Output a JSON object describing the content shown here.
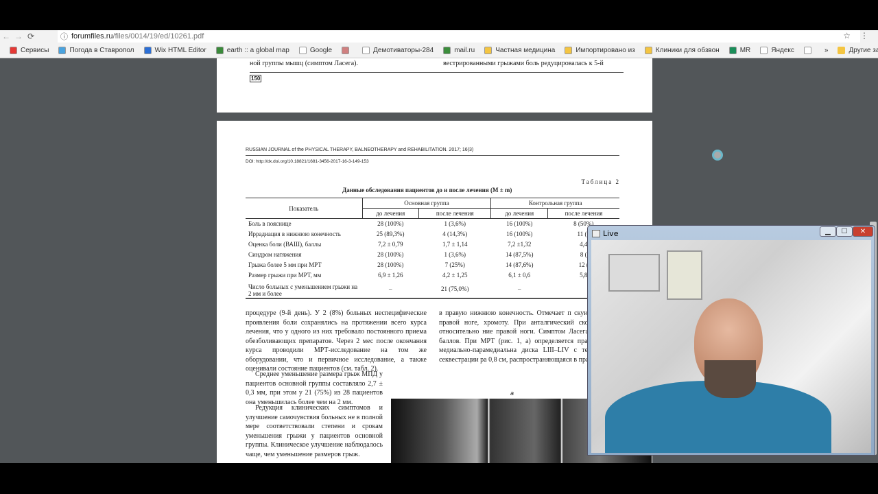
{
  "browser": {
    "url_host": "forumfiles.ru",
    "url_path": "/files/0014/19/ed/10261.pdf",
    "back_icon": "arrow-left-icon",
    "forward_icon": "arrow-right-icon",
    "reload_icon": "reload-icon",
    "info_icon": "info-icon",
    "star_icon": "star-icon",
    "menu_icon": "kebab-menu-icon"
  },
  "bookmarks": [
    {
      "label": "Сервисы",
      "icon": "apps-icon",
      "color": "#e53935"
    },
    {
      "label": "Погода в Ставропол",
      "icon": "weather-icon",
      "color": "#4aa3df"
    },
    {
      "label": "Wix HTML Editor",
      "icon": "wix-icon",
      "color": "#2b6fd6"
    },
    {
      "label": "earth :: a global map",
      "icon": "earth-icon",
      "color": "#3a8a3a"
    },
    {
      "label": "Google",
      "icon": "page-icon",
      "color": "#ffffff"
    },
    {
      "label": "",
      "icon": "avatar-icon",
      "color": "#d08080"
    },
    {
      "label": "Демотиваторы-284",
      "icon": "demotivator-icon",
      "color": "#ffffff"
    },
    {
      "label": "mail.ru",
      "icon": "mailru-icon",
      "color": "#3c8d3c"
    },
    {
      "label": "Частная медицина",
      "icon": "folder-icon",
      "color": "#f4c542"
    },
    {
      "label": "Импортировано из",
      "icon": "folder-icon",
      "color": "#f4c542"
    },
    {
      "label": "Клиники для обзвон",
      "icon": "folder-icon",
      "color": "#f4c542"
    },
    {
      "label": "MR",
      "icon": "mr-icon",
      "color": "#1b8e5a"
    },
    {
      "label": "Яндекс",
      "icon": "page-icon",
      "color": "#ffffff"
    },
    {
      "label": "",
      "icon": "page-icon",
      "color": "#ffffff"
    }
  ],
  "bookmarks_more": "»",
  "bookmarks_other": "Другие закладки",
  "page1": {
    "left_text": "ной группы мышц (симптом Ласега).",
    "right_text": "вестрированными грыжами боль редуцировалась к 5-й",
    "page_number": "150"
  },
  "page2": {
    "journal": "RUSSIAN JOURNAL of the PHYSICAL THERAPY, BALNEOTHERAPY and REHABILITATION. 2017; 16(3)",
    "doi": "DOI: http://dx.doi.org/10.18821/1681-3456-2017-16-3-149-153",
    "table_label": "Таблица 2",
    "table_title": "Данные обследования пациентов до и после лечения (M ± m)",
    "table": {
      "col_indicator": "Показатель",
      "group_main": "Основная группа",
      "group_control": "Контрольная группа",
      "sub": [
        "до лечения",
        "после лечения",
        "до лечения",
        "после лечения"
      ],
      "rows": [
        [
          "Боль в пояснице",
          "28 (100%)",
          "1 (3,6%)",
          "16 (100%)",
          "8 (50%)"
        ],
        [
          "Иррадиация в нижнюю конечность",
          "25 (89,3%)",
          "4 (14,3%)",
          "16 (100%)",
          "11 (6"
        ],
        [
          "Оценка боли (ВАШ), баллы",
          "7,2 ± 0,79",
          "1,7 ± 1,14",
          "7,2 ±1,32",
          "4,4"
        ],
        [
          "Синдром натяжения",
          "28 (100%)",
          "1 (3,6%)",
          "14 (87,5%)",
          "8 ("
        ],
        [
          "Грыжа более 5 мм при МРТ",
          "28 (100%)",
          "7 (25%)",
          "14 (87,6%)",
          "12 ("
        ],
        [
          "Размер грыжи при МРТ, мм",
          "6,9 ± 1,26",
          "4,2 ± 1,25",
          "6,1 ± 0,6",
          "5,8"
        ],
        [
          "Число больных с уменьшением грыжи на 2 мм и более",
          "–",
          "21 (75,0%)",
          "–",
          ""
        ]
      ]
    },
    "left_col_1": "процедуре (9-й день). У 2 (8%) больных неспецифические проявления боли сохранялись на протяжении всего курса лечения, что у одного из них требовало постоянного приема обезболивающих препаратов. Через 2 мес после окончания курса проводили МРТ-исследование на том же оборудовании, что и первичное исследование, а также оценивали состояние пациентов (см. табл. 2).",
    "left_col_2": "Среднее уменьшение размера грыж МПД у пациентов основной группы составляло 2,7 ± 0,3 мм, при этом у 21 (75%) из 28 пациентов она уменьшилась более чем на 2 мм.",
    "left_col_3": "Редукция клинических симптомов и улучшение самочувствия больных не в полной мере соответствовали степени и срокам уменьшения грыжи у пациентов основной группы. Клиническое улучшение наблюдалось чаще, чем уменьшение размеров грыж.",
    "right_col": "в правую нижнюю конечность. Отмечает п скую слабость в правой ноге, хромоту. При анталгический сколиоз влево, относительно ние правой ноги. Симптом Ласега справа 15° баллов. При МРТ (рис. 1, а) определяется правосторонняя медиально-парамедиальна диска LIII–LIV с тенденцией к секвестрации ра 0,8 см, распространяющаяся в правое межпо",
    "figure_label": "а"
  },
  "live_window": {
    "title": "Live",
    "minimize": "▁",
    "maximize": "☐",
    "close": "✕"
  }
}
